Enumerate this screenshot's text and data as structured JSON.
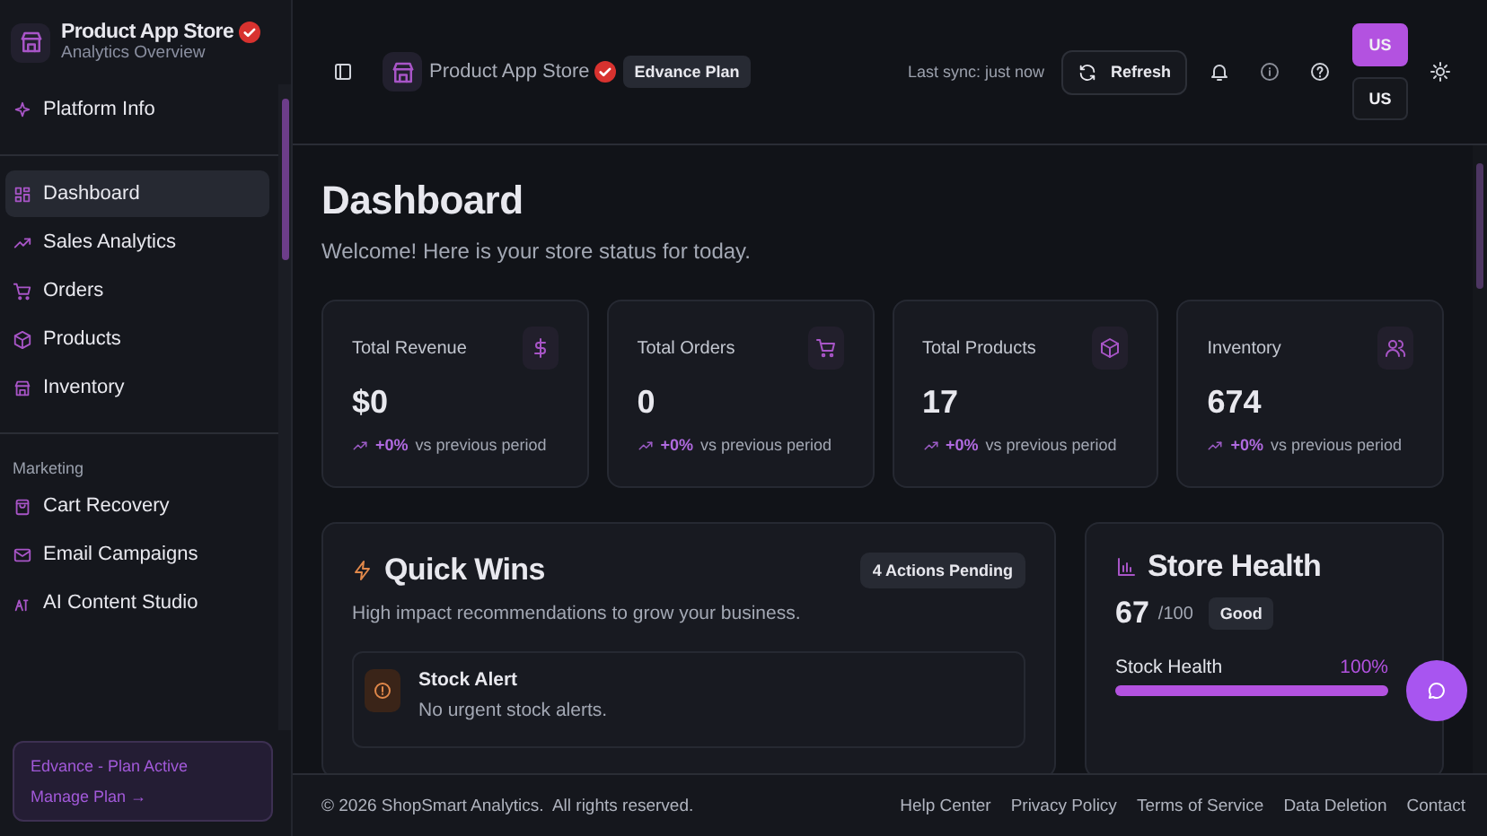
{
  "sidebar": {
    "brand": {
      "title": "Product App Store",
      "subtitle": "Analytics Overview",
      "verified": true
    },
    "top_items": [
      {
        "label": "Platform Info",
        "selected": false
      }
    ],
    "sections": [
      {
        "items": [
          {
            "label": "Dashboard",
            "selected": true
          },
          {
            "label": "Sales Analytics",
            "selected": false
          },
          {
            "label": "Orders",
            "selected": false
          },
          {
            "label": "Products",
            "selected": false
          },
          {
            "label": "Inventory",
            "selected": false
          }
        ]
      },
      {
        "heading": "Marketing",
        "items": [
          {
            "label": "Cart Recovery",
            "selected": false
          },
          {
            "label": "Email Campaigns",
            "selected": false
          },
          {
            "label": "AI Content Studio",
            "selected": false
          }
        ]
      }
    ],
    "plan_card": {
      "status": "Edvance - Plan Active",
      "link": "Manage Plan →"
    }
  },
  "header": {
    "store_name": "Product App Store",
    "verified": true,
    "plan_badge": "Edvance Plan",
    "sync": "Last sync: just now",
    "refresh_button": "Refresh",
    "user_buttons": [
      {
        "label": "US",
        "selected": true
      },
      {
        "label": "US",
        "selected": false
      }
    ]
  },
  "page": {
    "title": "Dashboard",
    "subtitle": "Welcome! Here is your store status for today.",
    "stats": [
      {
        "label": "Total Revenue",
        "value": "$0",
        "change": "+0%",
        "note": "vs previous period"
      },
      {
        "label": "Total Orders",
        "value": "0",
        "change": "+0%",
        "note": "vs previous period"
      },
      {
        "label": "Total Products",
        "value": "17",
        "change": "+0%",
        "note": "vs previous period"
      },
      {
        "label": "Inventory",
        "value": "674",
        "change": "+0%",
        "note": "vs previous period"
      }
    ],
    "quick_wins": {
      "title": "Quick Wins",
      "badge": "4 Actions Pending",
      "subtitle": "High impact recommendations to grow your business.",
      "alerts": [
        {
          "title": "Stock Alert",
          "text": "No urgent stock alerts."
        }
      ]
    },
    "store_health": {
      "title": "Store Health",
      "score": "67",
      "max": "/100",
      "rating": "Good",
      "metrics": [
        {
          "label": "Stock Health",
          "reading": "100%",
          "level": 1
        }
      ]
    }
  },
  "footer": {
    "copyright": "© 2026 ShopSmart Analytics.  All rights reserved.",
    "links": [
      "Help Center",
      "Privacy Policy",
      "Terms of Service",
      "Data Deletion",
      "Contact"
    ]
  }
}
